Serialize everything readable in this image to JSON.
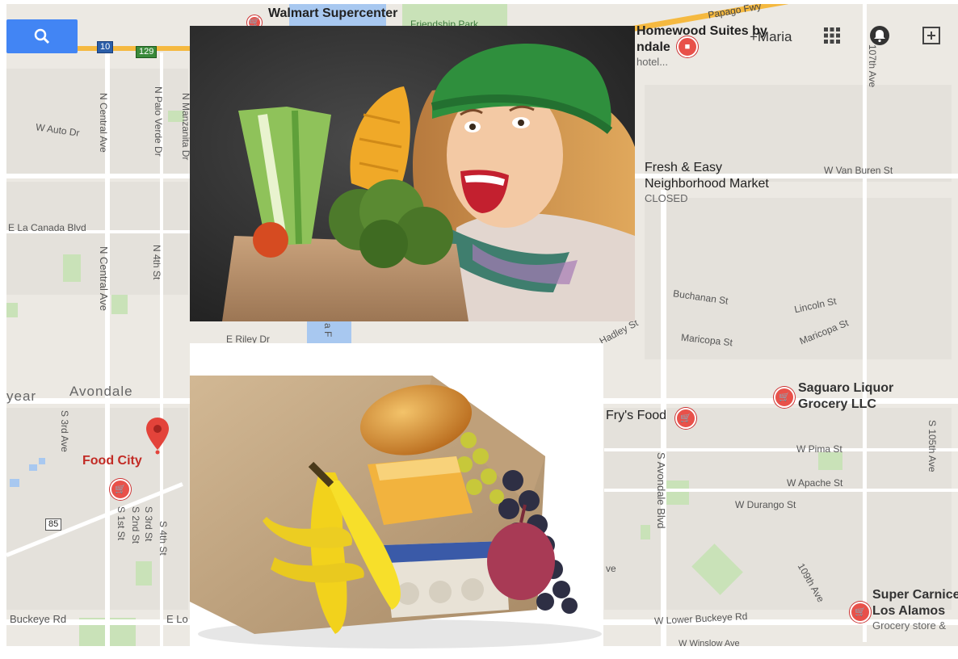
{
  "map": {
    "cities": [
      "Avondale",
      "year"
    ],
    "streets": [
      "W Auto Dr",
      "N Central Ave",
      "N Palo Verde Dr",
      "N Manzanita Dr",
      "E La Canada Blvd",
      "N 4th St",
      "E Riley Dr",
      "Buckeye Rd",
      "E Lo",
      "S 3rd Ave",
      "S 1st St",
      "S 2nd St",
      "S 3rd St",
      "S 4th St",
      "W Van Buren St",
      "Buchanan St",
      "Lincoln St",
      "Maricopa St",
      "Maricopa St",
      "Hadley St",
      "S Avondale Blvd",
      "W Pima St",
      "W Apache St",
      "W Durango St",
      "109th Ave",
      "S 105th Ave",
      "W Lower Buckeye Rd",
      "W Winslow Ave",
      "107th Ave",
      "Papago Fwy",
      "ve",
      "a F"
    ],
    "highways": [
      "10",
      "129",
      "85"
    ],
    "parks": [
      "Friendship Park"
    ],
    "places": {
      "walmart": "Walmart Supercenter",
      "homewood_line1": "Homewood Suites by",
      "homewood_line2": "ndale",
      "homewood_sub": "hotel...",
      "fresh_easy_line1": "Fresh & Easy",
      "fresh_easy_line2": "Neighborhood Market",
      "fresh_easy_status": "CLOSED",
      "saguaro_line1": "Saguaro Liquor",
      "saguaro_line2": "Grocery LLC",
      "frys": "Fry's Food",
      "food_city": "Food City",
      "super_line1": "Super Carnice",
      "super_line2": "Los Alamos",
      "super_sub": "Grocery store &"
    },
    "icons": [
      "search-icon",
      "apps-grid-icon",
      "notifications-icon",
      "share-plus-icon",
      "shopping-cart-icon",
      "map-pin-icon"
    ]
  },
  "topbar": {
    "user": "+Maria"
  },
  "colors": {
    "map_bg": "#ece9e3",
    "search_blue": "#4285f4",
    "pin_red": "#e8514a",
    "food_city_red": "#c22b25",
    "highway_orange": "#f5b940"
  }
}
